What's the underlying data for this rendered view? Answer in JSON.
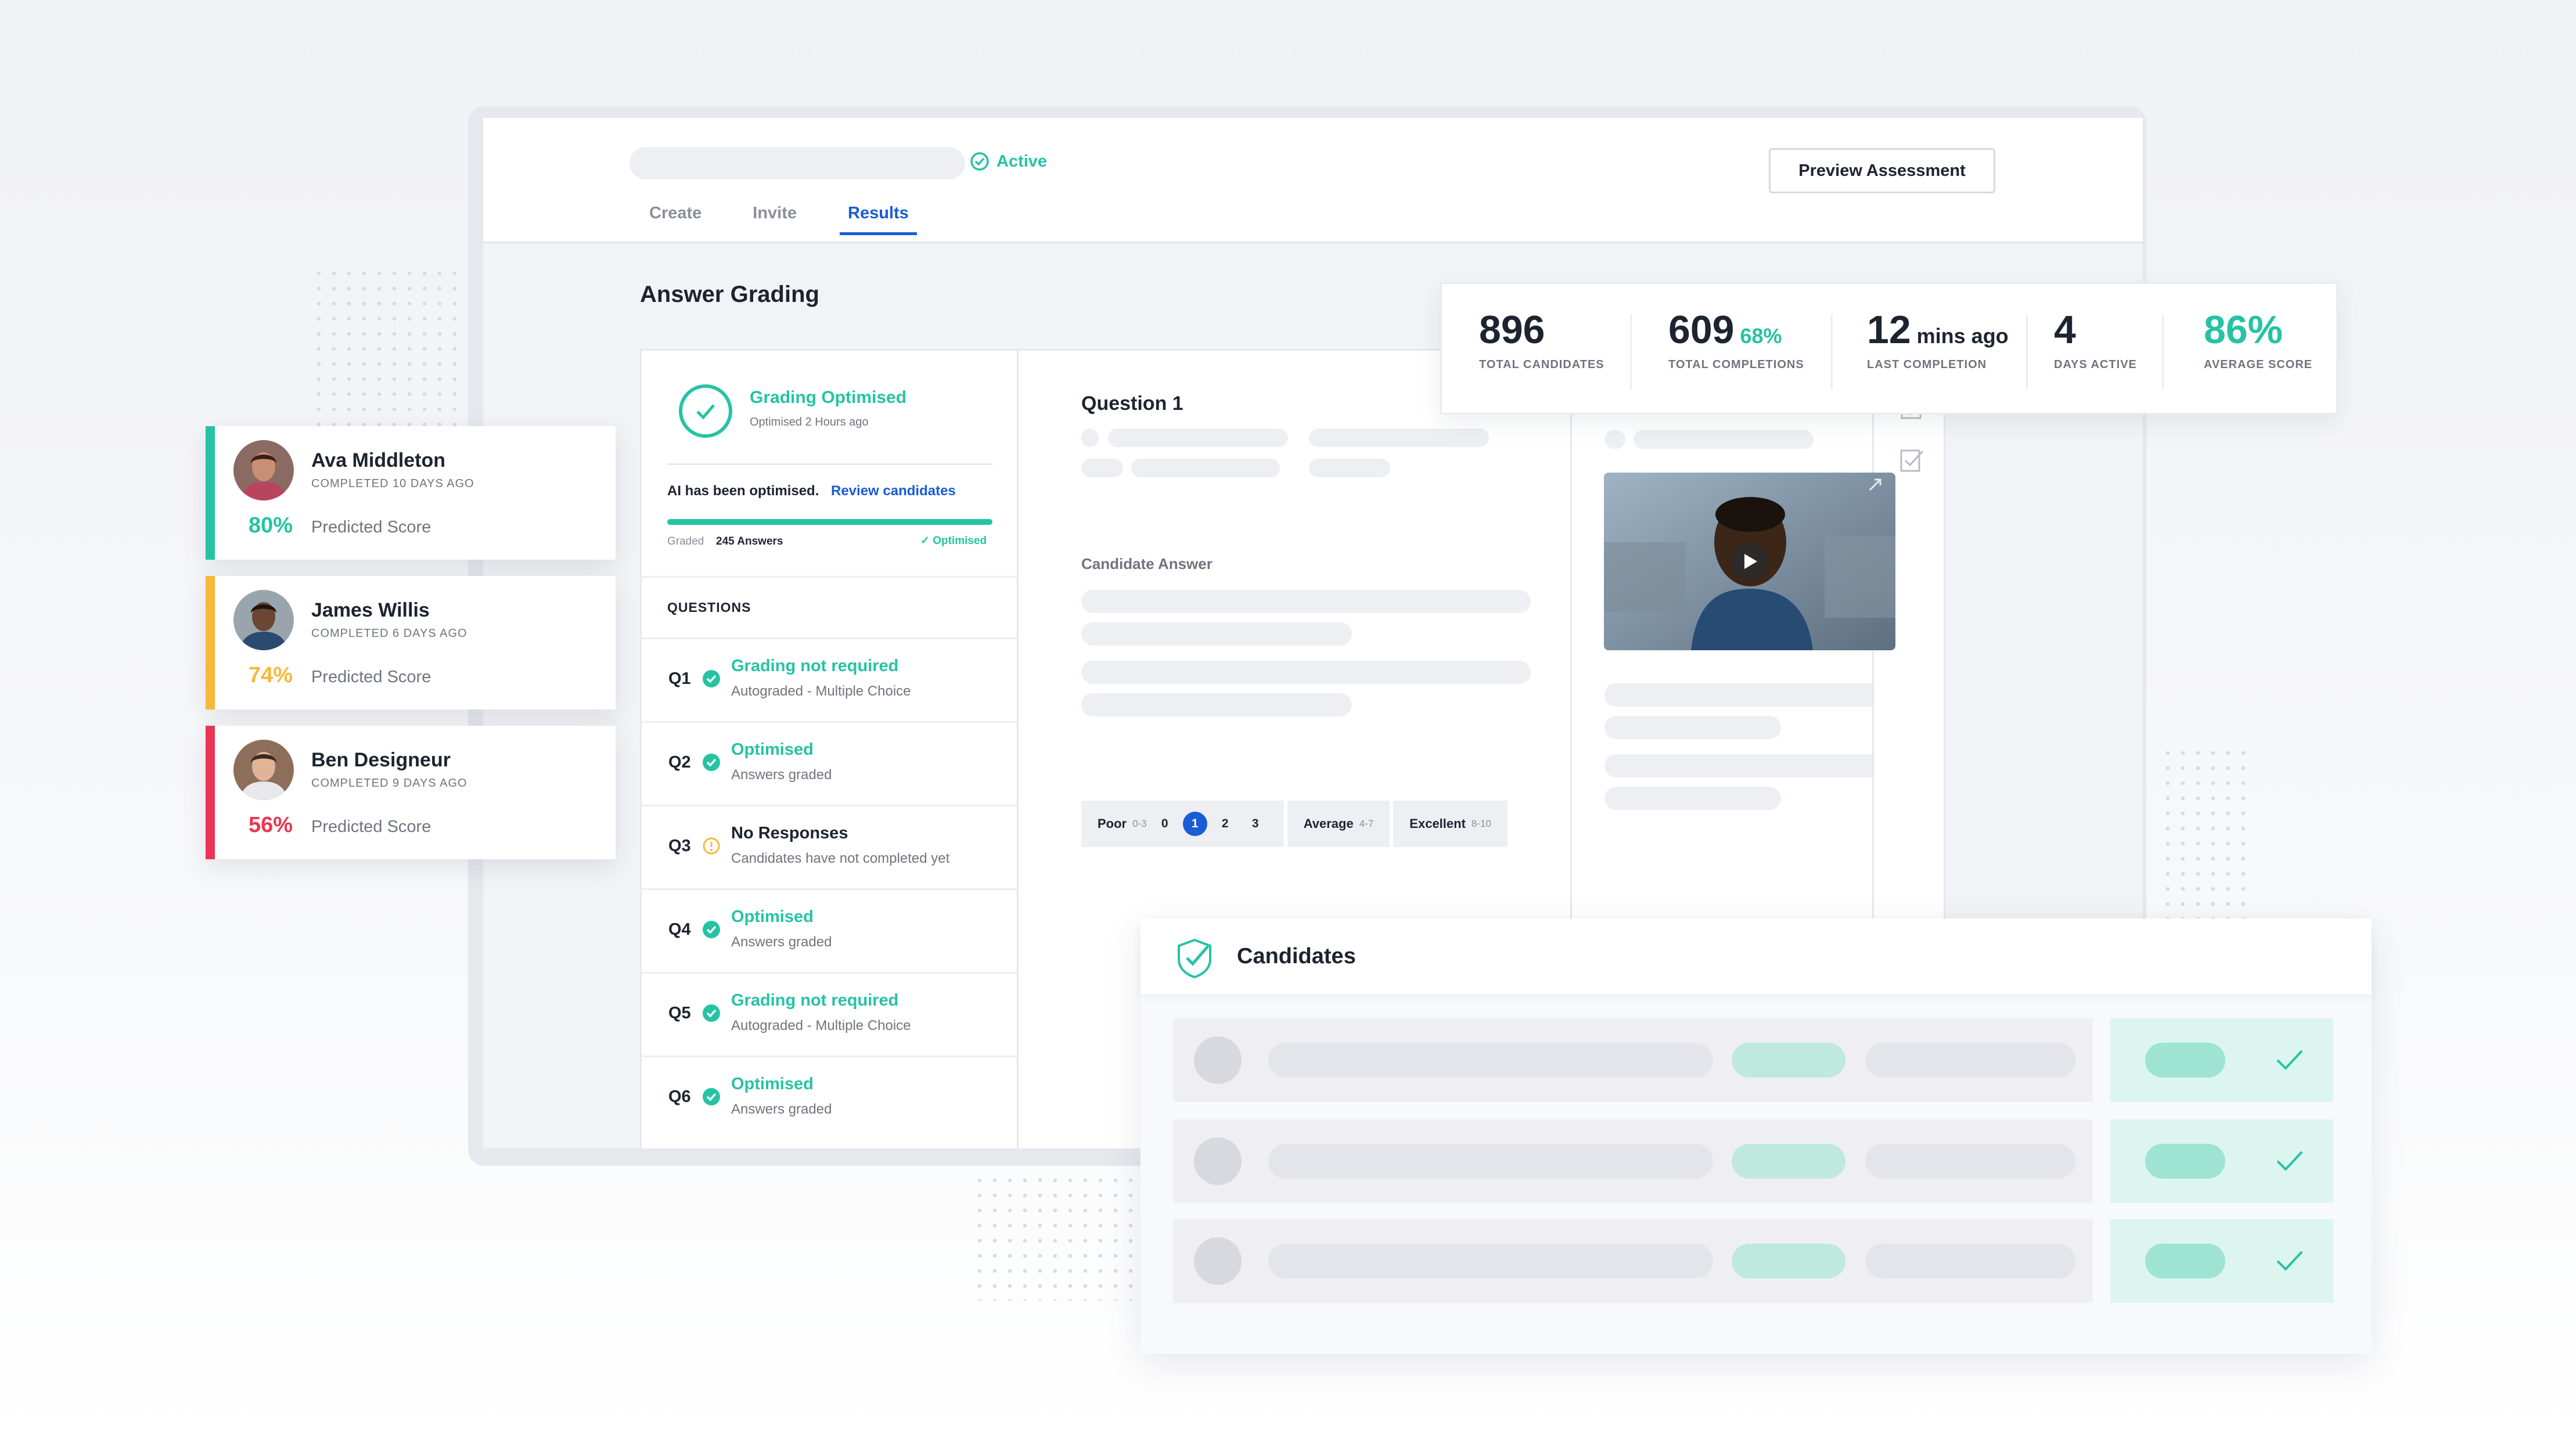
{
  "header": {
    "status": "Active",
    "preview_button": "Preview Assessment",
    "tabs": [
      "Create",
      "Invite",
      "Results"
    ],
    "active_tab": "Results"
  },
  "page_title": "Answer Grading",
  "grading": {
    "title": "Grading Optimised",
    "subtitle": "Optimised 2 Hours ago",
    "ai_text": "AI has been optimised.",
    "review_link": "Review candidates",
    "graded_label": "Graded",
    "graded_value": "245 Answers",
    "progress": 1.0,
    "optimised_label": "✓ Optimised"
  },
  "questions_header": "QUESTIONS",
  "questions": [
    {
      "num": "Q1",
      "title": "Grading not required",
      "sub": "Autograded - Multiple Choice",
      "state": "done"
    },
    {
      "num": "Q2",
      "title": "Optimised",
      "sub": "Answers graded",
      "state": "done"
    },
    {
      "num": "Q3",
      "title": "No Responses",
      "sub": "Candidates have not completed yet",
      "state": "pending"
    },
    {
      "num": "Q4",
      "title": "Optimised",
      "sub": "Answers graded",
      "state": "done"
    },
    {
      "num": "Q5",
      "title": "Grading not required",
      "sub": "Autograded - Multiple Choice",
      "state": "done"
    },
    {
      "num": "Q6",
      "title": "Optimised",
      "sub": "Answers graded",
      "state": "done"
    }
  ],
  "question_panel": {
    "title": "Question 1",
    "candidate_answer": "Candidate Answer"
  },
  "scale": {
    "poor": "Poor",
    "poor_range": "0-3",
    "values": [
      "0",
      "1",
      "2",
      "3"
    ],
    "selected": "1",
    "average": "Average",
    "average_range": "4-7",
    "excellent": "Excellent",
    "excellent_range": "8-10"
  },
  "stats": [
    {
      "value": "896",
      "extra": "",
      "label": "TOTAL CANDIDATES"
    },
    {
      "value": "609",
      "extra": "68%",
      "label": "TOTAL COMPLETIONS"
    },
    {
      "value": "12",
      "extra": "mins ago",
      "label": "LAST COMPLETION"
    },
    {
      "value": "4",
      "extra": "",
      "label": "DAYS ACTIVE"
    },
    {
      "value": "86%",
      "extra": "",
      "label": "AVERAGE SCORE"
    }
  ],
  "candidates_cards": [
    {
      "name": "Ava Middleton",
      "completed": "COMPLETED 10 DAYS AGO",
      "score": "80%",
      "label": "Predicted Score",
      "color": "#25c3a4"
    },
    {
      "name": "James Willis",
      "completed": "COMPLETED 6 DAYS AGO",
      "score": "74%",
      "label": "Predicted Score",
      "color": "#f6b93b"
    },
    {
      "name": "Ben Designeur",
      "completed": "COMPLETED 9 DAYS AGO",
      "score": "56%",
      "label": "Predicted Score",
      "color": "#ec3552"
    }
  ],
  "candidates_table": {
    "title": "Candidates"
  },
  "colors": {
    "accent_teal": "#25c3a4",
    "accent_blue": "#1a5bd6",
    "warning": "#f6b93b",
    "danger": "#ec3552"
  },
  "icons": [
    "check-circle-icon",
    "warning-circle-icon",
    "play-icon",
    "expand-icon",
    "document-icon",
    "checklist-icon",
    "shield-check-icon",
    "checkmark-icon"
  ]
}
